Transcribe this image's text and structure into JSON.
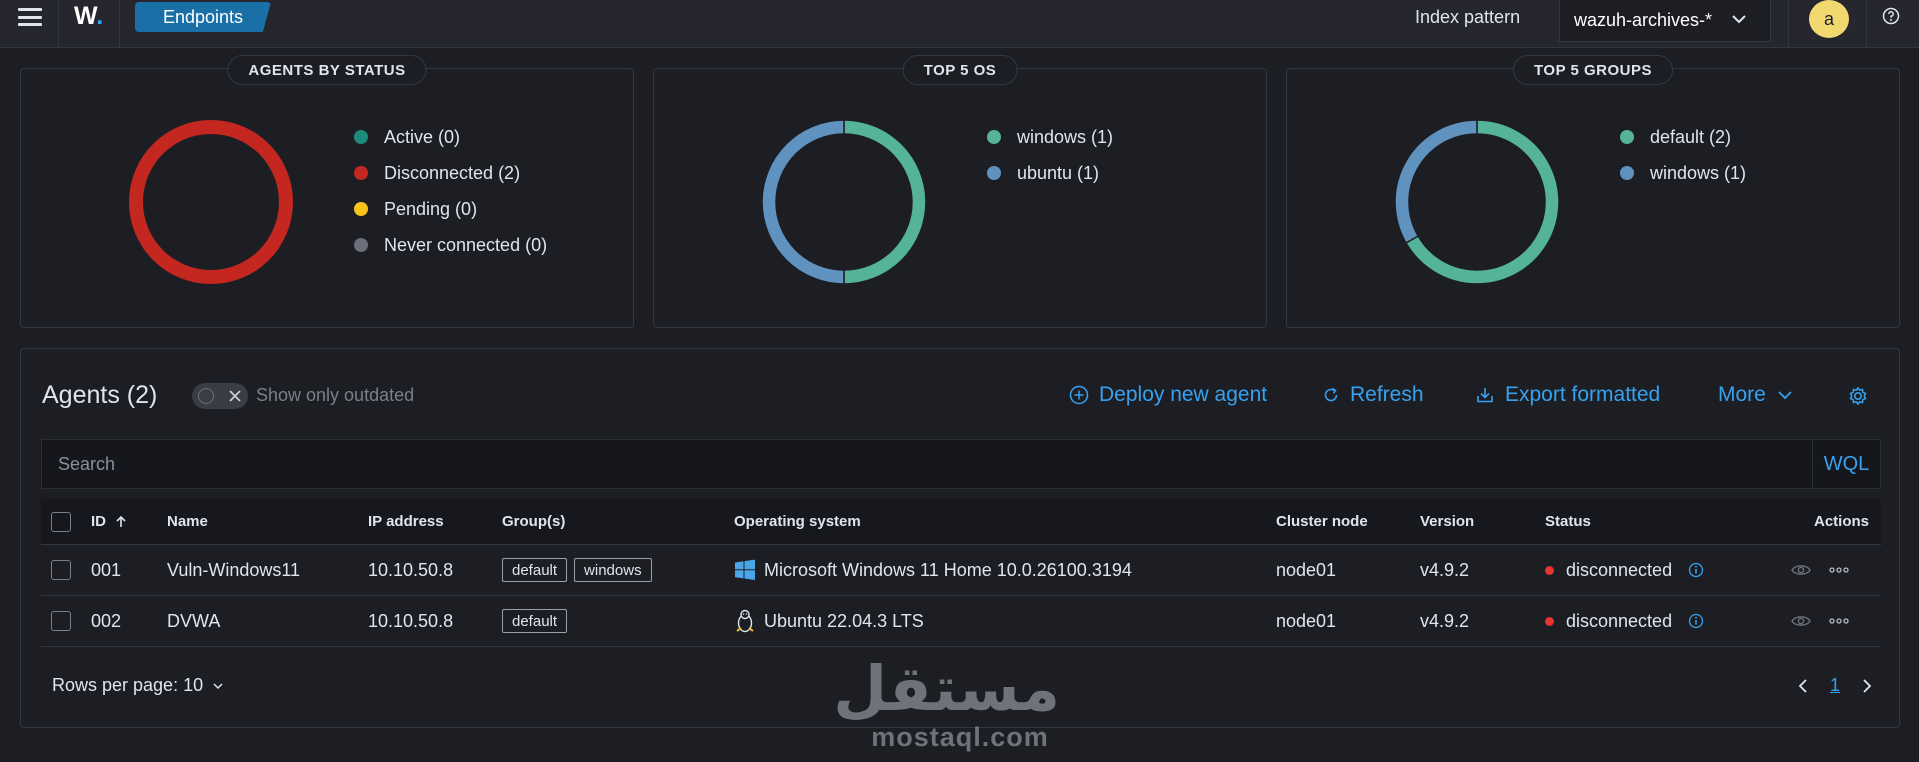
{
  "header": {
    "logo_text": "W",
    "breadcrumb": "Endpoints",
    "index_pattern_label": "Index pattern",
    "index_pattern_value": "wazuh-archives-*",
    "avatar_letter": "a"
  },
  "cards": [
    {
      "title": "AGENTS BY STATUS",
      "legend": [
        {
          "label": "Active (0)",
          "color": "#1e8a7a"
        },
        {
          "label": "Disconnected (2)",
          "color": "#c4271f"
        },
        {
          "label": "Pending (0)",
          "color": "#f5c518"
        },
        {
          "label": "Never connected (0)",
          "color": "#6a6e78"
        }
      ],
      "slices": [
        {
          "value": 2,
          "color": "#c4271f"
        }
      ]
    },
    {
      "title": "TOP 5 OS",
      "legend": [
        {
          "label": "windows (1)",
          "color": "#54b399"
        },
        {
          "label": "ubuntu (1)",
          "color": "#6092c0"
        }
      ],
      "slices": [
        {
          "value": 1,
          "color": "#54b399"
        },
        {
          "value": 1,
          "color": "#6092c0"
        }
      ]
    },
    {
      "title": "TOP 5 GROUPS",
      "legend": [
        {
          "label": "default (2)",
          "color": "#54b399"
        },
        {
          "label": "windows (1)",
          "color": "#6092c0"
        }
      ],
      "slices": [
        {
          "value": 2,
          "color": "#54b399"
        },
        {
          "value": 1,
          "color": "#6092c0"
        }
      ]
    }
  ],
  "agents": {
    "title": "Agents (2)",
    "toggle_label": "Show only outdated",
    "actions": {
      "deploy": "Deploy new agent",
      "refresh": "Refresh",
      "export": "Export formatted",
      "more": "More"
    },
    "search_placeholder": "Search",
    "wql": "WQL",
    "columns": {
      "id": "ID",
      "name": "Name",
      "ip": "IP address",
      "groups": "Group(s)",
      "os": "Operating system",
      "cluster": "Cluster node",
      "version": "Version",
      "status": "Status",
      "actions": "Actions"
    },
    "rows": [
      {
        "id": "001",
        "name": "Vuln-Windows11",
        "ip": "10.10.50.8",
        "groups": [
          "default",
          "windows"
        ],
        "os_icon": "windows-icon",
        "os": "Microsoft Windows 11 Home 10.0.26100.3194",
        "cluster": "node01",
        "version": "v4.9.2",
        "status": "disconnected"
      },
      {
        "id": "002",
        "name": "DVWA",
        "ip": "10.10.50.8",
        "groups": [
          "default"
        ],
        "os_icon": "linux-icon",
        "os": "Ubuntu 22.04.3 LTS",
        "cluster": "node01",
        "version": "v4.9.2",
        "status": "disconnected"
      }
    ],
    "rows_per_page": "Rows per page: 10",
    "current_page": "1"
  },
  "watermark": {
    "arabic": "مستقل",
    "latin": "mostaql.com"
  }
}
